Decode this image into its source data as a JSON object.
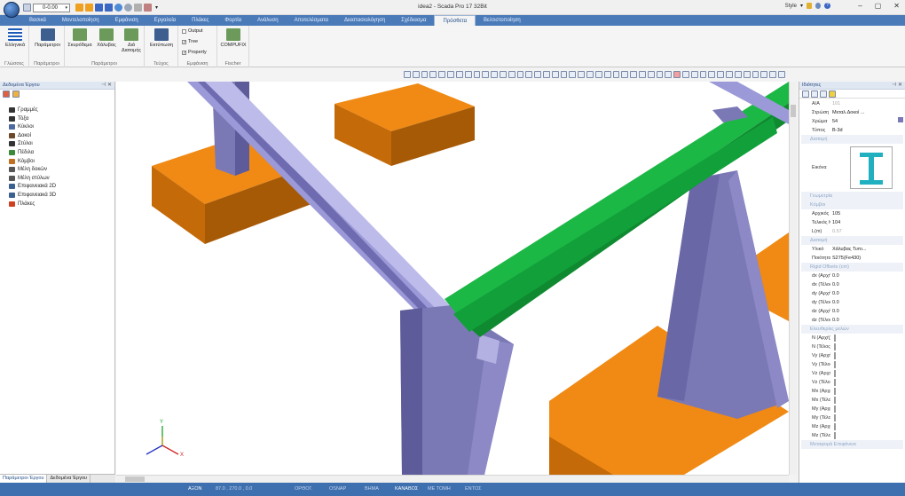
{
  "window": {
    "title": "idea2 - Scada Pro 17 32Bit",
    "style_label": "Style"
  },
  "qat": {
    "level_value": "0-0.00"
  },
  "menu": {
    "tabs": [
      "Βασικά",
      "Μοντελοποίηση",
      "Εμφάνιση",
      "Εργαλεία",
      "Πλάκες",
      "Φορτία",
      "Ανάλυση",
      "Αποτελέσματα",
      "Διαστασιολόγηση",
      "Σχέδιασμα",
      "Πρόσθετα",
      "Βελτιστοποίηση"
    ],
    "active_index": 10
  },
  "ribbon": {
    "groups": [
      {
        "label": "Γλώσσες",
        "buttons": [
          "Ελληνικά"
        ]
      },
      {
        "label": "Παράμετροι",
        "buttons": [
          "Παράμετροι"
        ]
      },
      {
        "label": "Παράμετροι",
        "buttons": [
          "Σκυρόδεμα",
          "Χάλυβας",
          "Διά Διατομής"
        ]
      },
      {
        "label": "Τεύχος",
        "buttons": [
          "Εκτύπωση"
        ]
      },
      {
        "label": "Εμφάνιση",
        "checks": [
          {
            "label": "Output",
            "checked": false
          },
          {
            "label": "Tree",
            "checked": true
          },
          {
            "label": "Property",
            "checked": true
          }
        ]
      },
      {
        "label": "Fischer",
        "buttons": [
          "COMPUFIX"
        ]
      }
    ]
  },
  "left_panel": {
    "title": "Δεδομένα Έργου",
    "items": [
      "Γραμμές",
      "Τόξα",
      "Κύκλοι",
      "Δοκοί",
      "Στύλοι",
      "Πέδιλα",
      "Κόμβοι",
      "Μέλη δοκών",
      "Μέλη στύλων",
      "Επιφανειακά 2D",
      "Επιφανειακά 3D",
      "Πλάκες"
    ],
    "tabs": [
      "Παράμετροι Έργου",
      "Δεδομένα Έργου"
    ]
  },
  "viewport": {
    "axes": {
      "x": "X",
      "y": "Y"
    }
  },
  "right_panel": {
    "title": "Ιδιότητες",
    "rows": [
      {
        "k": "Α/Α",
        "v": "101",
        "dim": true
      },
      {
        "k": "Στρώση",
        "v": "Μεταλ.Δοκοί ..."
      },
      {
        "k": "Χρώμα",
        "v": "54"
      },
      {
        "k": "Τύπος",
        "v": "B-3d"
      },
      {
        "section": "Διατομή"
      },
      {
        "k": "Εικόνα",
        "v": "",
        "image": true
      },
      {
        "section": "Γεωμετρία"
      },
      {
        "section": "Κόμβοι"
      },
      {
        "k": "Αρχικός Κόμβ...",
        "v": "105"
      },
      {
        "k": "Τελικός Κόμβος",
        "v": "104"
      },
      {
        "k": "L(m)",
        "v": "0.57",
        "dim": true
      },
      {
        "section": "Διατομή"
      },
      {
        "k": "Υλικό",
        "v": "Χάλυβας Τυπι..."
      },
      {
        "k": "Ποιότητα",
        "v": "S275(Fe430)"
      },
      {
        "section": "Rigid Offsets (cm)"
      },
      {
        "k": "dx (Αρχή)",
        "v": "0.0"
      },
      {
        "k": "dx (Τέλος)",
        "v": "0.0"
      },
      {
        "k": "dy (Αρχή)",
        "v": "0.0"
      },
      {
        "k": "dy (Τέλος)",
        "v": "0.0"
      },
      {
        "k": "dz (Αρχή)",
        "v": "0.0"
      },
      {
        "k": "dz (Τέλος)",
        "v": "0.0"
      },
      {
        "section": "Ελευθερίες μελών"
      },
      {
        "k": "N (Αρχή)",
        "v": "",
        "check": true
      },
      {
        "k": "N (Τέλος)",
        "v": "",
        "check": true
      },
      {
        "k": "Vy (Αρχή)",
        "v": "",
        "check": true
      },
      {
        "k": "Vy (Τέλος)",
        "v": "",
        "check": true
      },
      {
        "k": "Vz (Αρχή)",
        "v": "",
        "check": true
      },
      {
        "k": "Vz (Τέλος)",
        "v": "",
        "check": true
      },
      {
        "k": "Mx (Αρχή)",
        "v": "",
        "check": true
      },
      {
        "k": "Mx (Τέλος)",
        "v": "",
        "check": true
      },
      {
        "k": "My (Αρχή)",
        "v": "",
        "check": true
      },
      {
        "k": "My (Τέλος)",
        "v": "",
        "check": true
      },
      {
        "k": "Mz (Αρχή)",
        "v": "",
        "check": true
      },
      {
        "k": "Mz (Τέλος)",
        "v": "",
        "check": true
      },
      {
        "section": "Μεταφορά Επιφάνεια"
      }
    ]
  },
  "statusbar": {
    "items": [
      {
        "label": "ΑΞΟΝ",
        "on": true
      },
      {
        "label": "87.0 , 270.0 , 0.0",
        "on": false
      },
      {
        "label": "ΟΡΘΟΓ.",
        "on": false
      },
      {
        "label": "OSNAP",
        "on": false
      },
      {
        "label": "ΒΗΜΑ",
        "on": false
      },
      {
        "label": "ΚΑΝΑΒΟΣ",
        "on": true
      },
      {
        "label": "ΜΕ ΤΟΜΗ",
        "on": false
      },
      {
        "label": "ΕΝΤΟΣ",
        "on": false
      }
    ]
  },
  "colors": {
    "accent": "#3e6fae",
    "steel": "#7b78b6",
    "footing": "#e07b0c",
    "selected_beam": "#17a43c"
  }
}
